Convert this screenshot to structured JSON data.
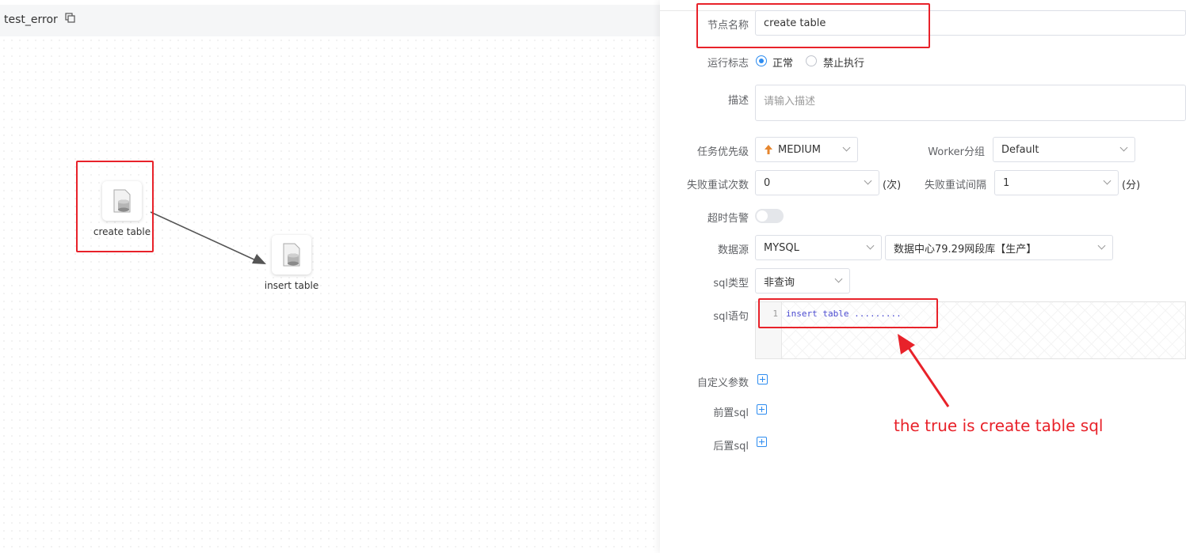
{
  "workflow": {
    "title": "test_error"
  },
  "canvas": {
    "nodes": [
      {
        "label": "create table"
      },
      {
        "label": "insert table"
      }
    ]
  },
  "form": {
    "node_name": {
      "label": "节点名称",
      "value": "create table"
    },
    "run_flag": {
      "label": "运行标志",
      "options": [
        "正常",
        "禁止执行"
      ],
      "selected": "正常"
    },
    "description": {
      "label": "描述",
      "placeholder": "请输入描述"
    },
    "priority": {
      "label": "任务优先级",
      "value": "MEDIUM"
    },
    "worker_group": {
      "label": "Worker分组",
      "value": "Default"
    },
    "retry_times": {
      "label": "失败重试次数",
      "value": "0",
      "unit": "(次)"
    },
    "retry_interval": {
      "label": "失败重试间隔",
      "value": "1",
      "unit": "(分)"
    },
    "timeout_alarm": {
      "label": "超时告警",
      "enabled": false
    },
    "datasource": {
      "label": "数据源",
      "type": "MYSQL",
      "name": "数据中心79.29网段库【生产】"
    },
    "sql_type": {
      "label": "sql类型",
      "value": "非查询"
    },
    "sql_statement": {
      "label": "sql语句",
      "line_number": "1",
      "code": "insert table ........."
    },
    "custom_params": {
      "label": "自定义参数"
    },
    "pre_sql": {
      "label": "前置sql"
    },
    "post_sql": {
      "label": "后置sql"
    }
  },
  "annotation": {
    "text": "the true is create table sql"
  },
  "colors": {
    "highlight": "#e8222a",
    "accent": "#2d8cf0",
    "priority_arrow": "#e6862e"
  }
}
